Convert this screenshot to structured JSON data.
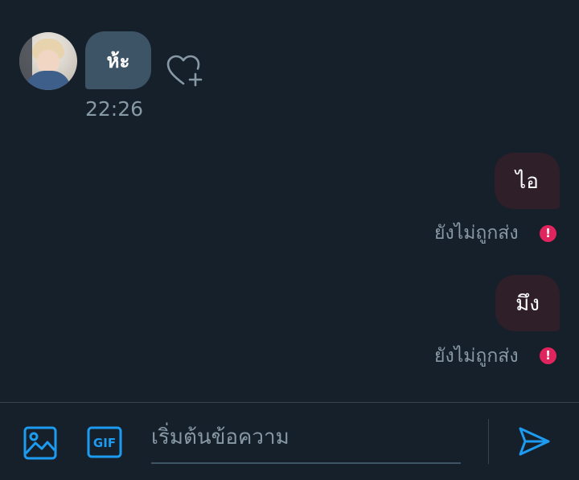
{
  "messages": {
    "incoming": {
      "text": "ห้ะ",
      "time": "22:26"
    },
    "outgoing": [
      {
        "text": "ไอ",
        "status": "ยังไม่ถูกส่ง"
      },
      {
        "text": "มึง",
        "status": "ยังไม่ถูกส่ง"
      }
    ]
  },
  "composer": {
    "placeholder": "เริ่มต้นข้อความ",
    "gif_label": "GIF"
  },
  "icons": {
    "like": "heart-plus-icon",
    "error": "error-exclamation-icon",
    "image": "image-icon",
    "gif": "gif-icon",
    "send": "send-icon"
  },
  "colors": {
    "background": "#16202a",
    "incoming_bubble": "#3d5466",
    "outgoing_bubble": "#2e1f29",
    "accent": "#1d9bf0",
    "error": "#e0245e",
    "muted_text": "#8899a6"
  }
}
